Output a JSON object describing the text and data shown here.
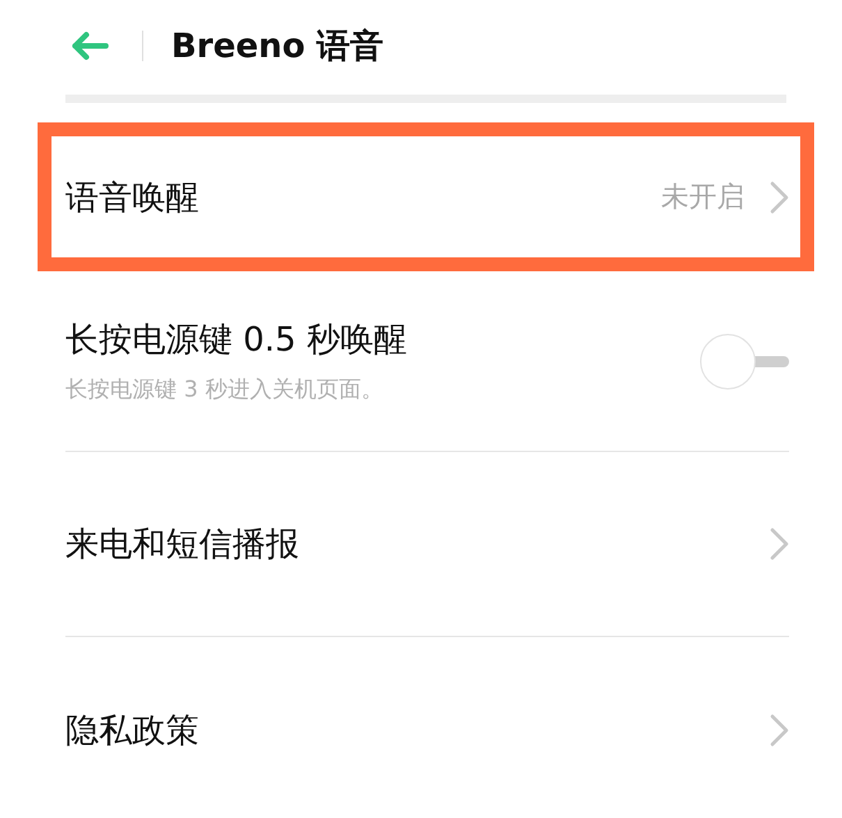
{
  "header": {
    "title": "Breeno 语音"
  },
  "settings": [
    {
      "kind": "link",
      "label": "语音唤醒",
      "value": "未开启",
      "highlighted": true
    },
    {
      "kind": "toggle",
      "label": "长按电源键 0.5 秒唤醒",
      "description": "长按电源键 3 秒进入关机页面。",
      "on": false,
      "highlighted": false
    },
    {
      "kind": "link",
      "label": "来电和短信播报",
      "highlighted": false
    },
    {
      "kind": "link",
      "label": "隐私政策",
      "highlighted": false
    }
  ]
}
